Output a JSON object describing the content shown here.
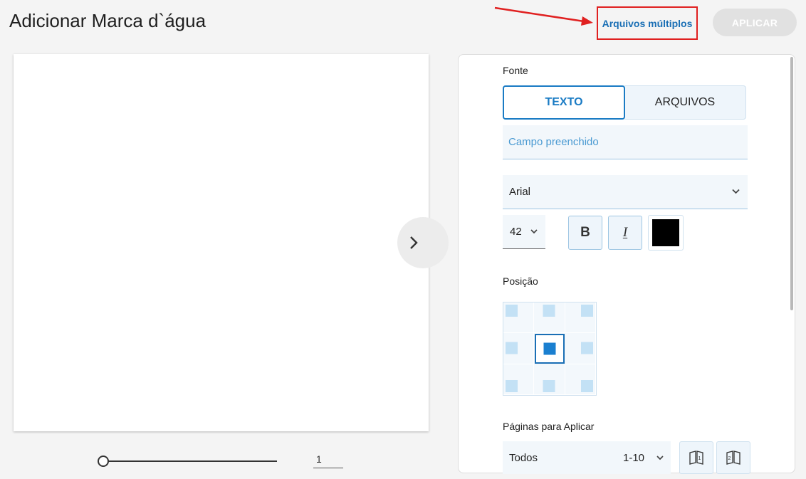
{
  "header": {
    "title": "Adicionar Marca d`água",
    "multi_files_link": "Arquivos múltiplos",
    "apply_button": "APLICAR"
  },
  "preview": {
    "page_number": "1"
  },
  "panel": {
    "font_label": "Fonte",
    "source_tabs": [
      {
        "label": "TEXTO",
        "selected": true
      },
      {
        "label": "ARQUIVOS",
        "selected": false
      }
    ],
    "text_value": "Campo preenchido",
    "font_family": "Arial",
    "font_size": "42",
    "bold_glyph": "B",
    "italic_glyph": "I",
    "color": "#000000",
    "position_label": "Posição",
    "position_selected": "middle-center",
    "pages_label": "Páginas para Aplicar",
    "pages_option": "Todos",
    "pages_range": "1-10"
  },
  "colors": {
    "accent": "#1a7bc4",
    "annotation": "#e02020",
    "apply_disabled": "#e1e1e1"
  }
}
